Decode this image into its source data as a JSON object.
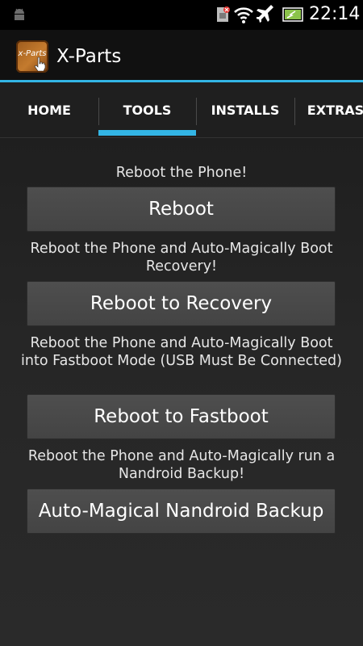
{
  "status_bar": {
    "time": "22:14",
    "icons": [
      "android-icon",
      "sim-icon",
      "wifi-icon",
      "airplane-icon",
      "battery-icon"
    ]
  },
  "action_bar": {
    "app_icon_text": "x-Parts",
    "title": "X-Parts",
    "accent_color": "#33b5e5"
  },
  "tabs": [
    {
      "label": "HOME",
      "selected": false
    },
    {
      "label": "TOOLS",
      "selected": true
    },
    {
      "label": "INSTALLS",
      "selected": false
    },
    {
      "label": "EXTRAS",
      "selected": false
    }
  ],
  "tools": [
    {
      "description": "Reboot the Phone!",
      "button": "Reboot"
    },
    {
      "description": "Reboot the Phone and Auto-Magically Boot Recovery!",
      "button": "Reboot to Recovery"
    },
    {
      "description": "Reboot the Phone and Auto-Magically Boot into Fastboot Mode (USB Must Be Connected)",
      "button": "Reboot to Fastboot"
    },
    {
      "description": "Reboot the Phone and Auto-Magically run a Nandroid Backup!",
      "button": "Auto-Magical Nandroid Backup"
    }
  ]
}
